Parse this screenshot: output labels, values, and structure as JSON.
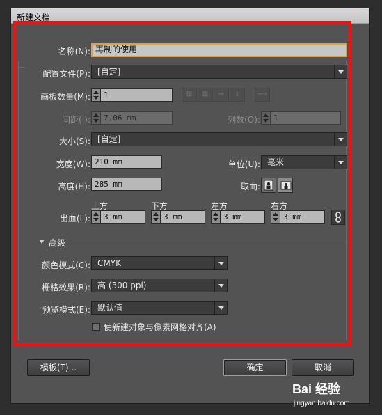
{
  "window": {
    "title": "新建文档"
  },
  "form": {
    "name_label": "名称(N):",
    "name_value": "再制的使用",
    "profile_label": "配置文件(P):",
    "profile_value": "[自定]",
    "artboards_label": "画板数量(M):",
    "artboards_value": "1",
    "spacing_label": "间距(I):",
    "spacing_value": "7.06 mm",
    "columns_label": "列数(O):",
    "columns_value": "1",
    "size_label": "大小(S):",
    "size_value": "[自定]",
    "width_label": "宽度(W):",
    "width_value": "210 mm",
    "units_label": "单位(U):",
    "units_value": "毫米",
    "height_label": "高度(H):",
    "height_value": "285 mm",
    "orientation_label": "取向:",
    "bleed_label": "出血(L):",
    "bleed": {
      "top_label": "上方",
      "top_value": "3 mm",
      "bottom_label": "下方",
      "bottom_value": "3 mm",
      "left_label": "左方",
      "left_value": "3 mm",
      "right_label": "右方",
      "right_value": "3 mm"
    }
  },
  "advanced": {
    "section_label": "高级",
    "color_mode_label": "颜色模式(C):",
    "color_mode_value": "CMYK",
    "raster_label": "栅格效果(R):",
    "raster_value": "高 (300 ppi)",
    "preview_label": "预览模式(E):",
    "preview_value": "默认值",
    "align_pixel_label": "使新建对象与像素网格对齐(A)"
  },
  "buttons": {
    "templates": "模板(T)...",
    "ok": "确定",
    "cancel": "取消"
  },
  "watermark": {
    "main": "Bai 经验",
    "sub": "jingyan.baidu.com"
  },
  "colors": {
    "highlight_frame": "#e01818",
    "focus_ring": "#d6a24c",
    "dialog_bg": "#535353"
  },
  "icons": [
    "grid-by-row-icon",
    "grid-by-column-icon",
    "arrange-by-row-icon",
    "arrange-by-column-icon",
    "change-layout-icon",
    "portrait-icon",
    "landscape-icon",
    "link-bleed-icon",
    "disclosure-triangle-icon",
    "dropdown-arrow-icon",
    "spinner-icon"
  ]
}
